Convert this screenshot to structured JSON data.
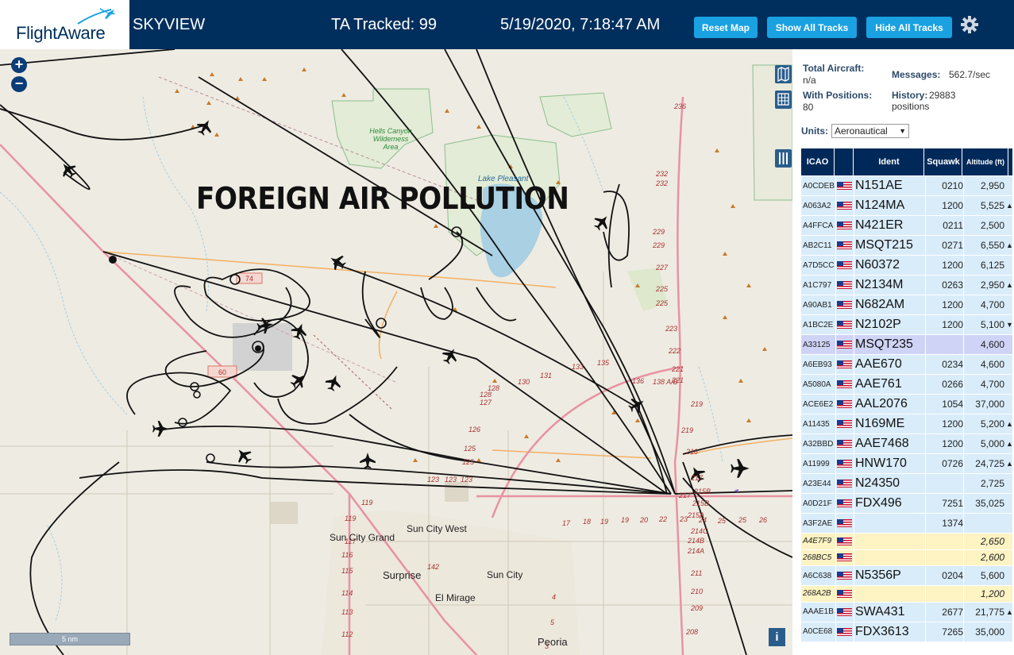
{
  "header": {
    "logo_text": "FlightAware",
    "app_title": "SKYVIEW",
    "ta_tracked": "TA Tracked: 99",
    "clock": "5/19/2020, 7:18:47 AM",
    "buttons": {
      "reset": "Reset Map",
      "show": "Show All Tracks",
      "hide": "Hide All Tracks"
    },
    "settings_icon": "gear-icon"
  },
  "map": {
    "zoom_in": "+",
    "zoom_out": "−",
    "overlay_title": "FOREIGN AIR POLLUTION",
    "scale_label": "5 nm",
    "info_label": "i",
    "places": {
      "sun_city_west": "Sun City West",
      "sun_city_grand": "Sun City Grand",
      "surprise": "Surprise",
      "sun_city": "Sun City",
      "el_mirage": "El Mirage",
      "peoria": "Peoria",
      "hells_canyon": "Hells Canyon\nWilderness\nArea",
      "lake_pleasant": "Lake Pleasant"
    },
    "controls": [
      "map-icon",
      "grid-icon",
      "columns-icon"
    ],
    "colors": {
      "land": "#eeebe2",
      "water": "#a9d0e3",
      "highway": "#e892a2",
      "tracks": "#111111",
      "park": "#2d8a3a"
    }
  },
  "panel": {
    "total_aircraft_label": "Total Aircraft:",
    "total_aircraft_value": "n/a",
    "with_positions_label": "With Positions:",
    "with_positions_value": "80",
    "messages_label": "Messages:",
    "messages_value": "562.7/sec",
    "history_label": "History:",
    "history_value": "29883 positions",
    "units_label": "Units:",
    "units_value": "Aeronautical",
    "columns": {
      "icao": "ICAO",
      "ident": "Ident",
      "squawk": "Squawk",
      "altitude": "Altitude (ft)"
    },
    "rows": [
      {
        "icao": "A0CDEB",
        "ident": "N151AE",
        "squawk": "0210",
        "alt": "2,950",
        "arrow": "",
        "kind": ""
      },
      {
        "icao": "A063A2",
        "ident": "N124MA",
        "squawk": "1200",
        "alt": "5,525",
        "arrow": "▲",
        "kind": ""
      },
      {
        "icao": "A4FFCA",
        "ident": "N421ER",
        "squawk": "0211",
        "alt": "2,500",
        "arrow": "",
        "kind": ""
      },
      {
        "icao": "AB2C11",
        "ident": "MSQT215",
        "squawk": "0271",
        "alt": "6,550",
        "arrow": "▲",
        "kind": ""
      },
      {
        "icao": "A7D5CC",
        "ident": "N60372",
        "squawk": "1200",
        "alt": "6,125",
        "arrow": "",
        "kind": ""
      },
      {
        "icao": "A1C797",
        "ident": "N2134M",
        "squawk": "0263",
        "alt": "2,950",
        "arrow": "▲",
        "kind": ""
      },
      {
        "icao": "A90AB1",
        "ident": "N682AM",
        "squawk": "1200",
        "alt": "4,700",
        "arrow": "",
        "kind": ""
      },
      {
        "icao": "A1BC2E",
        "ident": "N2102P",
        "squawk": "1200",
        "alt": "5,100",
        "arrow": "▼",
        "kind": ""
      },
      {
        "icao": "A33125",
        "ident": "MSQT235",
        "squawk": "",
        "alt": "4,600",
        "arrow": "",
        "kind": "sel"
      },
      {
        "icao": "A6EB93",
        "ident": "AAE670",
        "squawk": "0234",
        "alt": "4,600",
        "arrow": "",
        "kind": ""
      },
      {
        "icao": "A5080A",
        "ident": "AAE761",
        "squawk": "0266",
        "alt": "4,700",
        "arrow": "",
        "kind": ""
      },
      {
        "icao": "ACE6E2",
        "ident": "AAL2076",
        "squawk": "1054",
        "alt": "37,000",
        "arrow": "",
        "kind": ""
      },
      {
        "icao": "A11435",
        "ident": "N169ME",
        "squawk": "1200",
        "alt": "5,200",
        "arrow": "▲",
        "kind": ""
      },
      {
        "icao": "A32BBD",
        "ident": "AAE7468",
        "squawk": "1200",
        "alt": "5,000",
        "arrow": "▲",
        "kind": ""
      },
      {
        "icao": "A11999",
        "ident": "HNW170",
        "squawk": "0726",
        "alt": "24,725",
        "arrow": "▲",
        "kind": ""
      },
      {
        "icao": "A23E44",
        "ident": "N24350",
        "squawk": "",
        "alt": "2,725",
        "arrow": "",
        "kind": ""
      },
      {
        "icao": "A0D21F",
        "ident": "FDX496",
        "squawk": "7251",
        "alt": "35,025",
        "arrow": "",
        "kind": ""
      },
      {
        "icao": "A3F2AE",
        "ident": "",
        "squawk": "1374",
        "alt": "",
        "arrow": "",
        "kind": ""
      },
      {
        "icao": "A4E7F9",
        "ident": "",
        "squawk": "",
        "alt": "2,650",
        "arrow": "",
        "kind": "y"
      },
      {
        "icao": "268BC5",
        "ident": "",
        "squawk": "",
        "alt": "2,600",
        "arrow": "",
        "kind": "y"
      },
      {
        "icao": "A6C638",
        "ident": "N5356P",
        "squawk": "0204",
        "alt": "5,600",
        "arrow": "",
        "kind": ""
      },
      {
        "icao": "268A2B",
        "ident": "",
        "squawk": "",
        "alt": "1,200",
        "arrow": "",
        "kind": "y"
      },
      {
        "icao": "AAAE1B",
        "ident": "SWA431",
        "squawk": "2677",
        "alt": "21,775",
        "arrow": "▲",
        "kind": ""
      },
      {
        "icao": "A0CE68",
        "ident": "FDX3613",
        "squawk": "7265",
        "alt": "35,000",
        "arrow": "",
        "kind": ""
      }
    ]
  }
}
